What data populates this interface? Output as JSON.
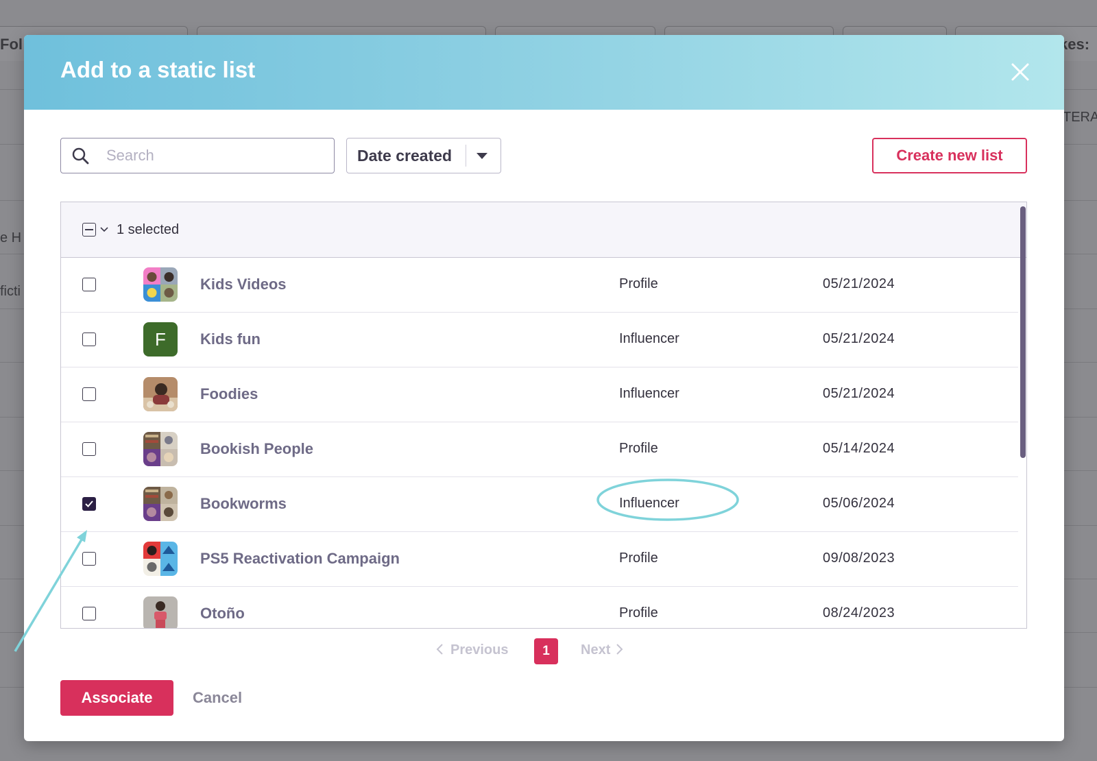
{
  "background": {
    "tab_left_label": "Fol",
    "tab_right_label": "kes:",
    "right_col_label": "TERA",
    "left_text_1": "e H",
    "left_text_2": "ficti"
  },
  "modal": {
    "title": "Add to a static list",
    "search": {
      "placeholder": "Search",
      "value": ""
    },
    "sort": {
      "selected": "Date created"
    },
    "create_label": "Create new list",
    "selection_text": "1 selected",
    "rows": [
      {
        "name": "Kids Videos",
        "type": "Profile",
        "date": "05/21/2024",
        "checked": false,
        "avatar": "collage"
      },
      {
        "name": "Kids fun",
        "type": "Influencer",
        "date": "05/21/2024",
        "checked": false,
        "avatar": "letter",
        "avatar_letter": "F",
        "avatar_color": "#3d6b2a"
      },
      {
        "name": "Foodies",
        "type": "Influencer",
        "date": "05/21/2024",
        "checked": false,
        "avatar": "photo"
      },
      {
        "name": "Bookish People",
        "type": "Profile",
        "date": "05/14/2024",
        "checked": false,
        "avatar": "collage"
      },
      {
        "name": "Bookworms",
        "type": "Influencer",
        "date": "05/06/2024",
        "checked": true,
        "avatar": "collage"
      },
      {
        "name": "PS5 Reactivation Campaign",
        "type": "Profile",
        "date": "09/08/2023",
        "checked": false,
        "avatar": "collage"
      },
      {
        "name": "Otoño",
        "type": "Profile",
        "date": "08/24/2023",
        "checked": false,
        "avatar": "photo"
      }
    ],
    "pagination": {
      "previous": "Previous",
      "current": "1",
      "next": "Next"
    },
    "associate_label": "Associate",
    "cancel_label": "Cancel"
  },
  "colors": {
    "accent": "#d8305c",
    "header_start": "#6fc0dc",
    "header_end": "#b2e6ec",
    "annotation": "#7fd3da",
    "checked": "#2b1f44"
  }
}
